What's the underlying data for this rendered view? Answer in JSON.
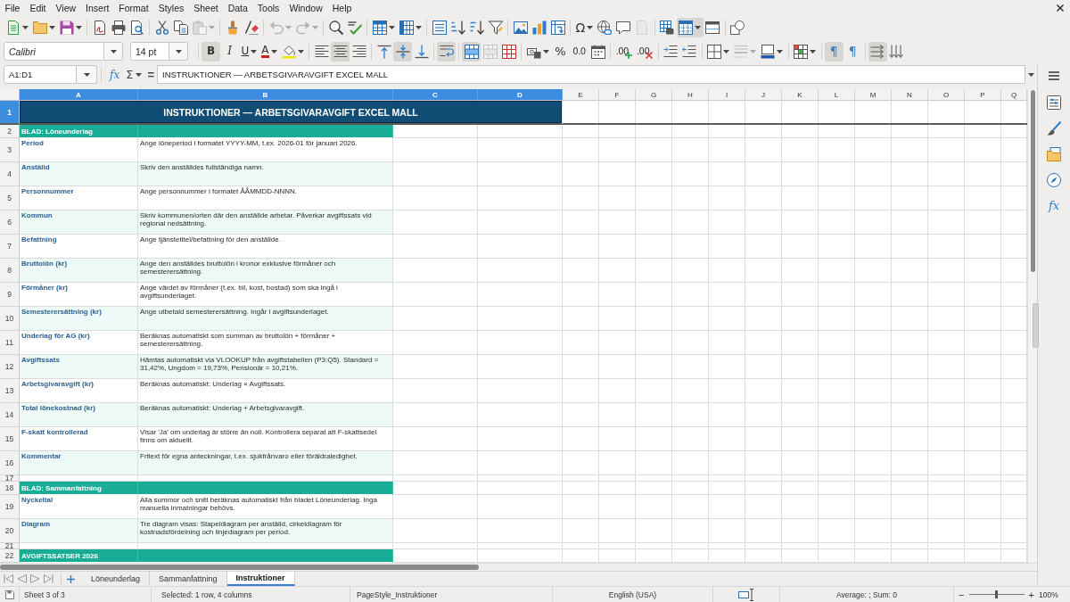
{
  "menu_bar": {
    "items": [
      "File",
      "Edit",
      "View",
      "Insert",
      "Format",
      "Styles",
      "Sheet",
      "Data",
      "Tools",
      "Window",
      "Help"
    ]
  },
  "standard_toolbar": {
    "buttons": [
      {
        "pressed": false,
        "disabled": false,
        "dropdown": true
      },
      {
        "pressed": false,
        "disabled": false,
        "dropdown": true
      },
      {
        "pressed": false,
        "disabled": false,
        "dropdown": true
      },
      {
        "pressed": false,
        "disabled": false,
        "dropdown": false
      },
      {
        "pressed": false,
        "disabled": false,
        "dropdown": false
      },
      {
        "pressed": false,
        "disabled": false,
        "dropdown": false
      },
      {
        "pressed": false,
        "disabled": false,
        "dropdown": false
      },
      {
        "pressed": false,
        "disabled": false,
        "dropdown": false
      },
      {
        "pressed": false,
        "disabled": true,
        "dropdown": true
      },
      {
        "pressed": false,
        "disabled": false,
        "dropdown": false
      },
      {
        "pressed": false,
        "disabled": false,
        "dropdown": false
      },
      {
        "pressed": false,
        "disabled": true,
        "dropdown": true
      },
      {
        "pressed": false,
        "disabled": true,
        "dropdown": true
      },
      {
        "pressed": false,
        "disabled": false,
        "dropdown": false
      },
      {
        "pressed": false,
        "disabled": false,
        "dropdown": false
      },
      {
        "pressed": false,
        "disabled": false,
        "dropdown": true
      },
      {
        "pressed": false,
        "disabled": false,
        "dropdown": true
      },
      {
        "pressed": false,
        "disabled": false,
        "dropdown": false
      },
      {
        "pressed": false,
        "disabled": false,
        "dropdown": false
      },
      {
        "pressed": false,
        "disabled": false,
        "dropdown": false
      },
      {
        "pressed": false,
        "disabled": false,
        "dropdown": false
      },
      {
        "pressed": false,
        "disabled": false,
        "dropdown": false
      },
      {
        "pressed": false,
        "disabled": false,
        "dropdown": false
      },
      {
        "pressed": false,
        "disabled": false,
        "dropdown": false
      },
      {
        "label": "Ω",
        "pressed": false,
        "disabled": false,
        "dropdown": true
      },
      {
        "pressed": false,
        "disabled": false,
        "dropdown": false
      },
      {
        "pressed": false,
        "disabled": false,
        "dropdown": false
      },
      {
        "pressed": false,
        "disabled": true,
        "dropdown": false
      },
      {
        "pressed": false,
        "disabled": false,
        "dropdown": false
      },
      {
        "pressed": true,
        "disabled": false,
        "dropdown": true
      },
      {
        "pressed": false,
        "disabled": false,
        "dropdown": false
      },
      {
        "pressed": false,
        "disabled": false,
        "dropdown": false
      }
    ]
  },
  "formatting_toolbar": {
    "font_name": "Calibri",
    "font_size": "14 pt",
    "buttons": [
      {
        "label": "B",
        "pressed": true,
        "disabled": false,
        "dropdown": false
      },
      {
        "label": "I",
        "pressed": false,
        "disabled": false,
        "dropdown": false
      },
      {
        "label": "U",
        "pressed": false,
        "disabled": false,
        "dropdown": true
      },
      {
        "label": "A",
        "pressed": false,
        "disabled": false,
        "dropdown": true
      },
      {
        "pressed": false,
        "disabled": false,
        "dropdown": true
      },
      {
        "pressed": false,
        "disabled": false,
        "dropdown": false
      },
      {
        "pressed": true,
        "disabled": false,
        "dropdown": false
      },
      {
        "pressed": false,
        "disabled": false,
        "dropdown": false
      },
      {
        "pressed": false,
        "disabled": false,
        "dropdown": false
      },
      {
        "pressed": true,
        "disabled": false,
        "dropdown": false
      },
      {
        "pressed": false,
        "disabled": false,
        "dropdown": false
      },
      {
        "pressed": true,
        "disabled": false,
        "dropdown": false
      },
      {
        "pressed": true,
        "disabled": false,
        "dropdown": false
      },
      {
        "pressed": false,
        "disabled": true,
        "dropdown": false
      },
      {
        "pressed": false,
        "disabled": false,
        "dropdown": false
      },
      {
        "pressed": false,
        "disabled": false,
        "dropdown": true
      },
      {
        "label": "%",
        "pressed": false,
        "disabled": false,
        "dropdown": false
      },
      {
        "label": "0.0",
        "pressed": false,
        "disabled": false,
        "dropdown": false
      },
      {
        "pressed": false,
        "disabled": false,
        "dropdown": false
      },
      {
        "label": ".00",
        "pressed": false,
        "disabled": false,
        "dropdown": false
      },
      {
        "label": ".00",
        "pressed": false,
        "disabled": false,
        "dropdown": false
      },
      {
        "pressed": false,
        "disabled": false,
        "dropdown": false
      },
      {
        "pressed": false,
        "disabled": false,
        "dropdown": false
      },
      {
        "pressed": false,
        "disabled": false,
        "dropdown": true
      },
      {
        "pressed": false,
        "disabled": true,
        "dropdown": true
      },
      {
        "pressed": false,
        "disabled": false,
        "dropdown": true
      },
      {
        "pressed": false,
        "disabled": false,
        "dropdown": true
      },
      {
        "label": "¶",
        "pressed": true,
        "disabled": false,
        "dropdown": false
      },
      {
        "label": "¶",
        "pressed": false,
        "disabled": false,
        "dropdown": false
      },
      {
        "pressed": true,
        "disabled": false,
        "dropdown": false
      },
      {
        "pressed": false,
        "disabled": false,
        "dropdown": false
      }
    ]
  },
  "formula_bar": {
    "name_box": "A1:D1",
    "function_wizard": "fx",
    "sum": "Σ",
    "formula": "=",
    "content": "INSTRUKTIONER — ARBETSGIVARAVGIFT EXCEL MALL"
  },
  "sheet": {
    "columns": [
      {
        "label": "A",
        "selected": true
      },
      {
        "label": "B",
        "selected": true
      },
      {
        "label": "C",
        "selected": true
      },
      {
        "label": "D",
        "selected": true
      },
      {
        "label": "E",
        "selected": false
      },
      {
        "label": "F",
        "selected": false
      },
      {
        "label": "G",
        "selected": false
      },
      {
        "label": "H",
        "selected": false
      },
      {
        "label": "I",
        "selected": false
      },
      {
        "label": "J",
        "selected": false
      },
      {
        "label": "K",
        "selected": false
      },
      {
        "label": "L",
        "selected": false
      },
      {
        "label": "M",
        "selected": false
      },
      {
        "label": "N",
        "selected": false
      },
      {
        "label": "O",
        "selected": false
      },
      {
        "label": "P",
        "selected": false
      },
      {
        "label": "Q",
        "selected": false
      }
    ],
    "rows": [
      {
        "number": "1",
        "selected": true,
        "kind": "title",
        "cells": [
          "INSTRUKTIONER — ARBETSGIVARAVGIFT EXCEL MALL"
        ]
      },
      {
        "number": "2",
        "selected": false,
        "kind": "section",
        "cells": [
          "BLAD: Löneunderlag"
        ]
      },
      {
        "number": "3",
        "selected": false,
        "kind": "field",
        "shaded": false,
        "cells": [
          "Period",
          "Ange löneperiod i formatet YYYY-MM, t.ex. 2026-01 för januari 2026."
        ]
      },
      {
        "number": "4",
        "selected": false,
        "kind": "field",
        "shaded": true,
        "cells": [
          "Anställd",
          "Skriv den anställdes fullständiga namn."
        ]
      },
      {
        "number": "5",
        "selected": false,
        "kind": "field",
        "shaded": false,
        "cells": [
          "Personnummer",
          "Ange personnummer i formatet ÅÅMMDD-NNNN."
        ]
      },
      {
        "number": "6",
        "selected": false,
        "kind": "field",
        "shaded": true,
        "cells": [
          "Kommun",
          "Skriv kommunen/orten där den anställde arbetar. Påverkar avgiftssats vid regional nedsättning."
        ]
      },
      {
        "number": "7",
        "selected": false,
        "kind": "field",
        "shaded": false,
        "cells": [
          "Befattning",
          "Ange tjänstetitel/befattning för den anställde."
        ]
      },
      {
        "number": "8",
        "selected": false,
        "kind": "field",
        "shaded": true,
        "cells": [
          "Bruttolön (kr)",
          "Ange den anställdes bruttolön i kronor exklusive förmåner och semesterersättning."
        ]
      },
      {
        "number": "9",
        "selected": false,
        "kind": "field",
        "shaded": false,
        "cells": [
          "Förmåner (kr)",
          "Ange värdet av förmåner (t.ex. bil, kost, bostad) som ska ingå i avgiftsunderlaget."
        ]
      },
      {
        "number": "10",
        "selected": false,
        "kind": "field",
        "shaded": true,
        "cells": [
          "Semesterersättning (kr)",
          "Ange utbetald semesterersättning. Ingår i avgiftsunderlaget."
        ]
      },
      {
        "number": "11",
        "selected": false,
        "kind": "field",
        "shaded": false,
        "cells": [
          "Underlag för AG (kr)",
          "Beräknas automatiskt som summan av bruttolön + förmåner + semesterersättning."
        ]
      },
      {
        "number": "12",
        "selected": false,
        "kind": "field",
        "shaded": true,
        "cells": [
          "Avgiftssats",
          "Hämtas automatiskt via VLOOKUP från avgiftstabellen (P3:Q5). Standard = 31,42%, Ungdom = 19,73%, Pensionär = 10,21%."
        ]
      },
      {
        "number": "13",
        "selected": false,
        "kind": "field",
        "shaded": false,
        "cells": [
          "Arbetsgivaravgift (kr)",
          "Beräknas automatiskt: Underlag × Avgiftssats."
        ]
      },
      {
        "number": "14",
        "selected": false,
        "kind": "field",
        "shaded": true,
        "cells": [
          "Total lönekostnad (kr)",
          "Beräknas automatiskt: Underlag + Arbetsgivaravgift."
        ]
      },
      {
        "number": "15",
        "selected": false,
        "kind": "field",
        "shaded": false,
        "cells": [
          "F-skatt kontrollerad",
          "Visar 'Ja' om underlag är större än noll. Kontrollera separat att F-skattsedel finns om aktuellt."
        ]
      },
      {
        "number": "16",
        "selected": false,
        "kind": "field",
        "shaded": true,
        "cells": [
          "Kommentar",
          "Fritext för egna anteckningar, t.ex. sjukfrånvaro eller föräldraledighet."
        ]
      },
      {
        "number": "17",
        "selected": false,
        "kind": "blank"
      },
      {
        "number": "18",
        "selected": false,
        "kind": "section",
        "cells": [
          "BLAD: Sammanfattning"
        ]
      },
      {
        "number": "19",
        "selected": false,
        "kind": "field",
        "shaded": false,
        "cells": [
          "Nyckeltal",
          "Alla summor och snitt beräknas automatiskt från bladet Löneunderlag. Inga manuella inmatningar behövs."
        ]
      },
      {
        "number": "20",
        "selected": false,
        "kind": "field",
        "shaded": true,
        "cells": [
          "Diagram",
          "Tre diagram visas: Stapeldiagram per anställd, cirkeldiagram för kostnadsfördelning och linjediagram per period."
        ]
      },
      {
        "number": "21",
        "selected": false,
        "kind": "blank"
      },
      {
        "number": "22",
        "selected": false,
        "kind": "section",
        "cells": [
          "AVGIFTSSATSER 2026"
        ]
      }
    ]
  },
  "sheet_tabs": [
    {
      "label": "Löneunderlag",
      "selected": false
    },
    {
      "label": "Sammanfattning",
      "selected": false
    },
    {
      "label": "Instruktioner",
      "selected": true
    }
  ],
  "sidebar": {
    "functions_label": "fx"
  },
  "status_bar": {
    "sheet": "Sheet 3 of 3",
    "selection": "Selected: 1 row, 4 columns",
    "page_style": "PageStyle_Instruktioner",
    "language": "English (USA)",
    "summary": "Average: ; Sum: 0",
    "zoom_out": "−",
    "zoom_slider": {
      "level": 0.5
    },
    "zoom_in": "+",
    "zoom": "100%"
  }
}
